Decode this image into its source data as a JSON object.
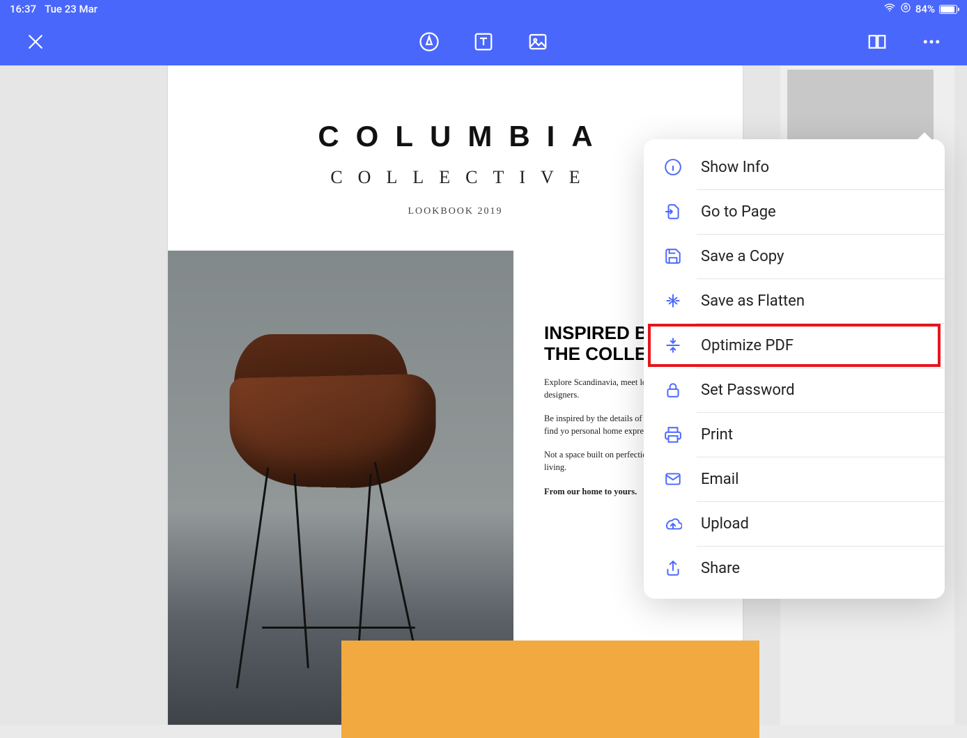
{
  "status": {
    "time": "16:37",
    "date": "Tue 23 Mar",
    "battery": "84%"
  },
  "document": {
    "title": "COLUMBIA",
    "subtitle": "COLLECTIVE",
    "lookbook": "LOOKBOOK 2019",
    "headline1": "INSPIRED B",
    "headline2": "THE COLLE",
    "para1": "Explore Scandinavia, meet lo and renowned designers.",
    "para2": "Be inspired by the details of design and passion to find yo personal home expression.",
    "para3": "Not a space built on perfectio home made for living.",
    "para4": "From our home to yours."
  },
  "menu": {
    "items": [
      {
        "label": "Show Info",
        "icon": "info-icon"
      },
      {
        "label": "Go to Page",
        "icon": "goto-page-icon"
      },
      {
        "label": "Save a Copy",
        "icon": "save-icon"
      },
      {
        "label": "Save as Flatten",
        "icon": "flatten-icon"
      },
      {
        "label": "Optimize PDF",
        "icon": "optimize-icon",
        "highlighted": true
      },
      {
        "label": "Set Password",
        "icon": "lock-icon"
      },
      {
        "label": "Print",
        "icon": "print-icon"
      },
      {
        "label": "Email",
        "icon": "email-icon"
      },
      {
        "label": "Upload",
        "icon": "upload-icon"
      },
      {
        "label": "Share",
        "icon": "share-icon"
      }
    ]
  }
}
